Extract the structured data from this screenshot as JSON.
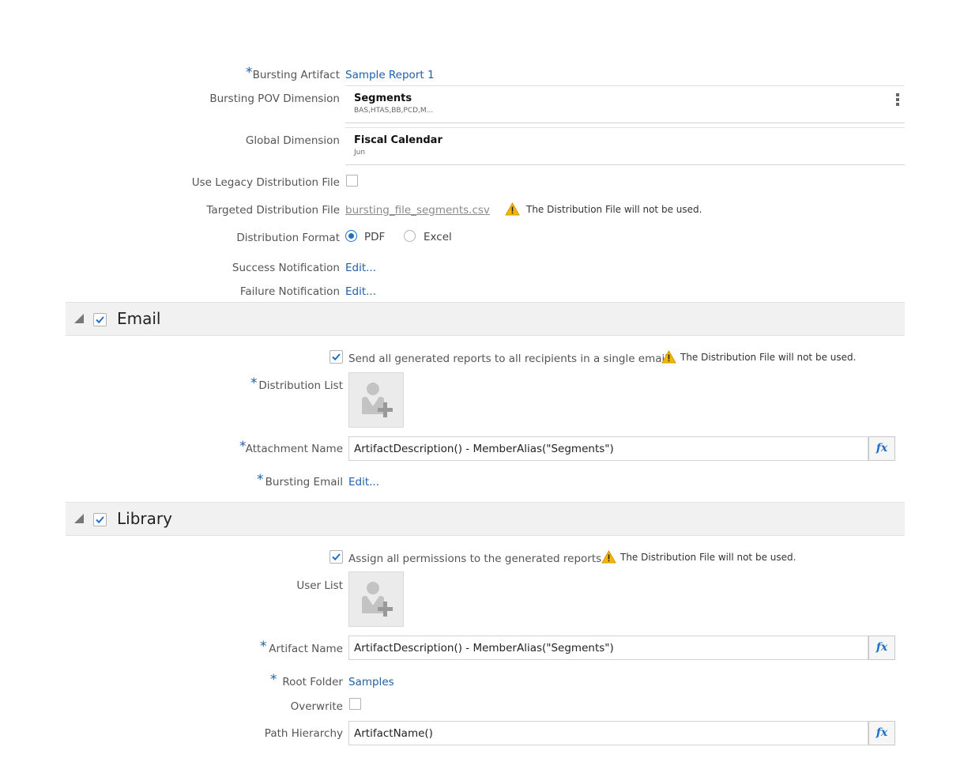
{
  "general": {
    "bursting_artifact": {
      "label": "Bursting Artifact",
      "value": "Sample Report 1"
    },
    "pov_dimension": {
      "label": "Bursting POV Dimension",
      "title": "Segments",
      "members": "BAS,HTAS,BB,PCD,M..."
    },
    "global_dimension": {
      "label": "Global Dimension",
      "title": "Fiscal Calendar",
      "members": "Jun"
    },
    "legacy_file": {
      "label": "Use Legacy Distribution File"
    },
    "targeted_file": {
      "label": "Targeted Distribution File",
      "value": "bursting_file_segments.csv",
      "warning": "The Distribution File will not be used."
    },
    "format": {
      "label": "Distribution Format",
      "options": [
        "PDF",
        "Excel"
      ],
      "selected": "PDF"
    },
    "success_notification": {
      "label": "Success Notification",
      "value": "Edit..."
    },
    "failure_notification": {
      "label": "Failure Notification",
      "value": "Edit..."
    }
  },
  "email": {
    "title": "Email",
    "single_email": {
      "label": "Send all generated reports to all recipients in a single email",
      "warning": "The Distribution File will not be used."
    },
    "distribution_list": {
      "label": "Distribution List"
    },
    "attachment_name": {
      "label": "Attachment Name",
      "value": "ArtifactDescription() - MemberAlias(\"Segments\")"
    },
    "bursting_email": {
      "label": "Bursting Email",
      "value": "Edit..."
    }
  },
  "library": {
    "title": "Library",
    "assign_permissions": {
      "label": "Assign all permissions to the generated reports",
      "warning": "The Distribution File will not be used."
    },
    "user_list": {
      "label": "User List"
    },
    "artifact_name": {
      "label": "Artifact Name",
      "value": "ArtifactDescription() - MemberAlias(\"Segments\")"
    },
    "root_folder": {
      "label": "Root Folder",
      "value": "Samples"
    },
    "overwrite": {
      "label": "Overwrite"
    },
    "path_hierarchy": {
      "label": "Path Hierarchy",
      "value": "ArtifactName()"
    }
  },
  "common": {
    "required_mark": "*",
    "fx_label": "fx"
  },
  "colors": {
    "accent": "#1f5fa8",
    "warning": "#f2b600",
    "section_bg": "#f1f1f1"
  },
  "icons": [
    "warning-icon",
    "checkmark-icon",
    "user-add-icon",
    "fx-icon",
    "kebab-menu-icon",
    "collapse-triangle-icon"
  ]
}
